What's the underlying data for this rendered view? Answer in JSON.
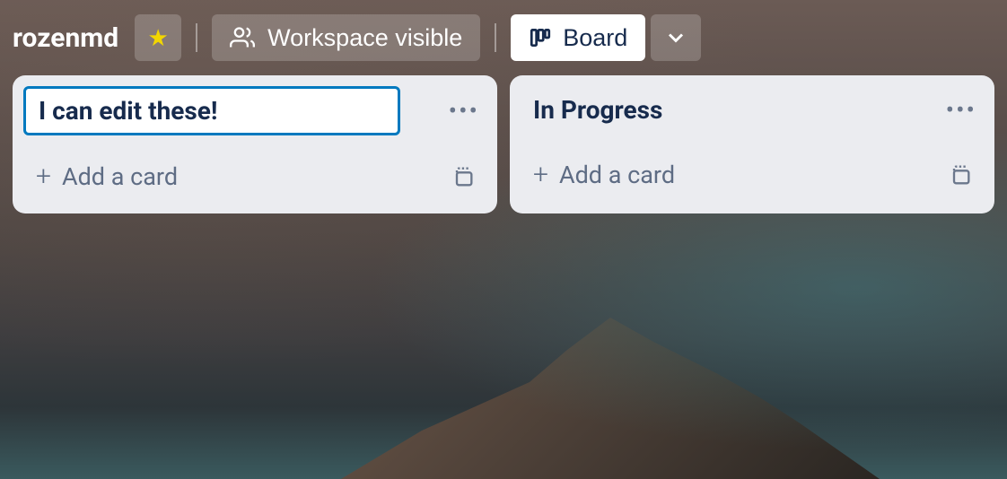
{
  "header": {
    "board_name": "rozenmd",
    "visibility_label": "Workspace visible",
    "view_label": "Board"
  },
  "lists": [
    {
      "title": "I can edit these!",
      "editing": true,
      "add_card_label": "Add a card"
    },
    {
      "title": "In Progress",
      "editing": false,
      "add_card_label": "Add a card"
    }
  ]
}
